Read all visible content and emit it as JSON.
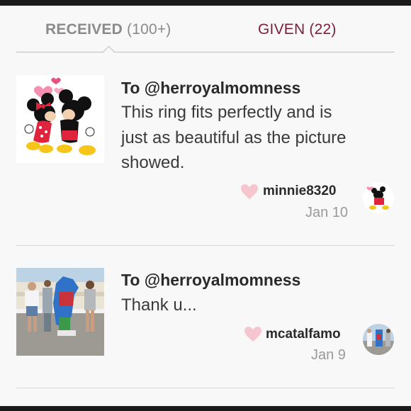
{
  "tabs": {
    "received": {
      "label": "RECEIVED",
      "count": "(100+)"
    },
    "given": {
      "label": "GIVEN (22)"
    }
  },
  "feedback": [
    {
      "to": "To @herroyalmomness",
      "message_lines": [
        "This ring fits perfectly and is",
        "just as beautiful as the picture",
        "showed."
      ],
      "username": "minnie8320",
      "date": "Jan 10",
      "thumbnail_icon": "minnie-mickey-kissing-image",
      "like_icon": "heart-icon"
    },
    {
      "to": "To @herroyalmomness",
      "message_lines": [
        "Thank u..."
      ],
      "username": "mcatalfamo",
      "date": "Jan 9",
      "thumbnail_icon": "family-photo-image",
      "like_icon": "heart-icon"
    }
  ],
  "colors": {
    "given_tab": "#7a1f3a",
    "received_tab": "#8a8a8a",
    "heart": "#f5c6cf",
    "background": "#f8f8f8"
  }
}
